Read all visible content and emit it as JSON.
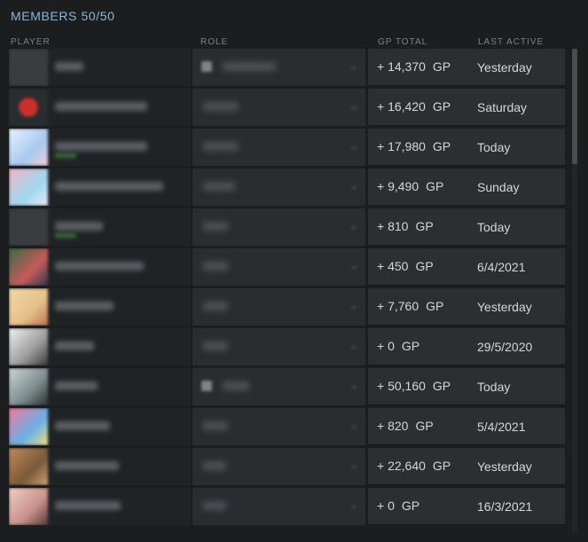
{
  "header": {
    "title": "MEMBERS 50/50"
  },
  "columns": {
    "player": "PLAYER",
    "role": "ROLE",
    "gp_total": "GP TOTAL",
    "last_active": "LAST ACTIVE"
  },
  "gp_unit": "GP",
  "members": [
    {
      "gp": "+ 14,370",
      "last_active": "Yesterday"
    },
    {
      "gp": "+ 16,420",
      "last_active": "Saturday"
    },
    {
      "gp": "+ 17,980",
      "last_active": "Today"
    },
    {
      "gp": "+ 9,490",
      "last_active": "Sunday"
    },
    {
      "gp": "+ 810",
      "last_active": "Today"
    },
    {
      "gp": "+ 450",
      "last_active": "6/4/2021"
    },
    {
      "gp": "+ 7,760",
      "last_active": "Yesterday"
    },
    {
      "gp": "+ 0",
      "last_active": "29/5/2020"
    },
    {
      "gp": "+ 50,160",
      "last_active": "Today"
    },
    {
      "gp": "+ 820",
      "last_active": "5/4/2021"
    },
    {
      "gp": "+ 22,640",
      "last_active": "Yesterday"
    },
    {
      "gp": "+ 0",
      "last_active": "16/3/2021"
    }
  ],
  "colors": {
    "title": "#8fb6d6",
    "header_text": "#7d8287",
    "row_background": "#2c2f32",
    "page_background": "#1b1d1f"
  }
}
